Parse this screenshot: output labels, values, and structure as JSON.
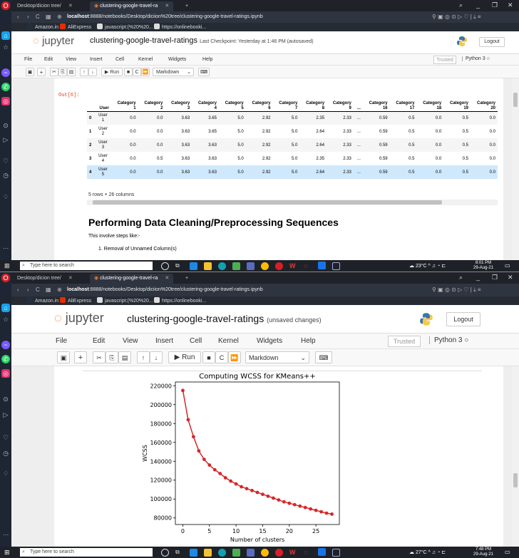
{
  "browser": {
    "tab1_title": "Desktop/dicion tree/",
    "tab2_title": "clustering-google-travel-ra",
    "new_tab": "+",
    "url_host": "localhost",
    "url_rest": ":8888/notebooks/Desktop/diciion%20tree/clustering-google-travel-ratings.ipynb",
    "bookmarks": [
      "Amazon.in",
      "AliExpress",
      "javascript:(%20%20...",
      "https://onlinebooki..."
    ]
  },
  "jupyter": {
    "logo_text": "jupyter",
    "notebook_name": "clustering-google-travel-ratings",
    "checkpoint_1": "Last Checkpoint: Yesterday at 1:46 PM  (autosaved)",
    "checkpoint_2": "(unsaved changes)",
    "logout": "Logout",
    "menu": [
      "File",
      "Edit",
      "View",
      "Insert",
      "Cell",
      "Kernel",
      "Widgets",
      "Help"
    ],
    "trusted": "Trusted",
    "kernel": "Python 3",
    "run_label": "Run",
    "cell_type": "Markdown"
  },
  "output": {
    "prompt": "Out[6]:",
    "columns": [
      {
        "l1": "User",
        "l2": ""
      },
      {
        "l1": "Category",
        "l2": "1"
      },
      {
        "l1": "Category",
        "l2": "2"
      },
      {
        "l1": "Category",
        "l2": "3"
      },
      {
        "l1": "Category",
        "l2": "4"
      },
      {
        "l1": "Category",
        "l2": "5"
      },
      {
        "l1": "Category",
        "l2": "6"
      },
      {
        "l1": "Category",
        "l2": "7"
      },
      {
        "l1": "Category",
        "l2": "8"
      },
      {
        "l1": "Category",
        "l2": "9"
      },
      {
        "l1": "...",
        "l2": ""
      },
      {
        "l1": "Category",
        "l2": "16"
      },
      {
        "l1": "Category",
        "l2": "17"
      },
      {
        "l1": "Category",
        "l2": "18"
      },
      {
        "l1": "Category",
        "l2": "19"
      },
      {
        "l1": "Category",
        "l2": "20"
      }
    ],
    "rows": [
      {
        "idx": "0",
        "u1": "User",
        "u2": "1",
        "vals": [
          "0.0",
          "0.0",
          "3.63",
          "3.65",
          "5.0",
          "2.92",
          "5.0",
          "2.35",
          "2.33",
          "...",
          "0.59",
          "0.5",
          "0.0",
          "0.5",
          "0.0"
        ]
      },
      {
        "idx": "1",
        "u1": "User",
        "u2": "2",
        "vals": [
          "0.0",
          "0.0",
          "3.63",
          "3.65",
          "5.0",
          "2.92",
          "5.0",
          "2.64",
          "2.33",
          "...",
          "0.59",
          "0.5",
          "0.0",
          "0.5",
          "0.0"
        ]
      },
      {
        "idx": "2",
        "u1": "User",
        "u2": "3",
        "vals": [
          "0.0",
          "0.0",
          "3.63",
          "3.63",
          "5.0",
          "2.92",
          "5.0",
          "2.64",
          "2.33",
          "...",
          "0.59",
          "0.5",
          "0.0",
          "0.5",
          "0.0"
        ]
      },
      {
        "idx": "3",
        "u1": "User",
        "u2": "4",
        "vals": [
          "0.0",
          "0.5",
          "3.63",
          "3.63",
          "5.0",
          "2.92",
          "5.0",
          "2.35",
          "2.33",
          "...",
          "0.59",
          "0.5",
          "0.0",
          "0.5",
          "0.0"
        ]
      },
      {
        "idx": "4",
        "u1": "User",
        "u2": "5",
        "vals": [
          "0.0",
          "0.0",
          "3.63",
          "3.63",
          "5.0",
          "2.92",
          "5.0",
          "2.64",
          "2.33",
          "...",
          "0.59",
          "0.5",
          "0.0",
          "0.5",
          "0.0"
        ]
      }
    ],
    "shape_note": "5 rows × 26 columns"
  },
  "markdown": {
    "heading": "Performing Data Cleaning/Preprocessing Sequences",
    "intro": "This involve steps like:-",
    "item1": "1. Removal of Unnamed Column(s)"
  },
  "taskbar": {
    "search_placeholder": "Type here to search",
    "weather_1": "23°C",
    "weather_2": "27°C",
    "time_1": "8:01 PM",
    "date_1": "29-Aug-21",
    "time_2": "7:48 PM",
    "date_2": "29-Aug-21"
  },
  "colors": {
    "line": "#d62728",
    "accent": "#f37626"
  },
  "chart_data": {
    "type": "line",
    "title": "Computing WCSS for KMeans++",
    "xlabel": "Number of clusters",
    "ylabel": "WCSS",
    "xlim": [
      -1.4,
      29.4
    ],
    "ylim": [
      73000,
      224000
    ],
    "xticks": [
      0,
      5,
      10,
      15,
      20,
      25
    ],
    "yticks": [
      80000,
      100000,
      120000,
      140000,
      160000,
      180000,
      200000,
      220000
    ],
    "x": [
      0,
      1,
      2,
      3,
      4,
      5,
      6,
      7,
      8,
      9,
      10,
      11,
      12,
      13,
      14,
      15,
      16,
      17,
      18,
      19,
      20,
      21,
      22,
      23,
      24,
      25,
      26,
      27,
      28
    ],
    "values": [
      215000,
      184000,
      166000,
      151000,
      142000,
      136000,
      131000,
      127000,
      122500,
      119000,
      116000,
      113000,
      111000,
      109000,
      107000,
      105000,
      103000,
      101000,
      99000,
      97000,
      95500,
      94000,
      92500,
      91000,
      89500,
      88000,
      86500,
      85000,
      84000
    ]
  }
}
